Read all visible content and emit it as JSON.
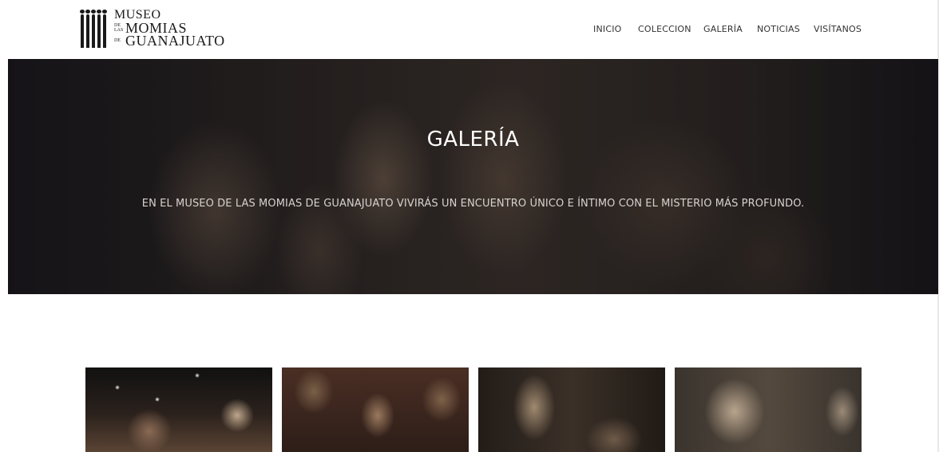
{
  "brand": {
    "line1": "MUSEO",
    "small_de1": "DE",
    "small_las": "LAS",
    "small_de2": "DE",
    "line2": "MOMIAS",
    "line3": "GUANAJUATO"
  },
  "nav": {
    "items": [
      {
        "label": "INICIO"
      },
      {
        "label": "COLECCION"
      },
      {
        "label": "GALERÍA"
      },
      {
        "label": "NOTICIAS"
      },
      {
        "label": "VISÍTANOS"
      }
    ]
  },
  "hero": {
    "title": "GALERÍA",
    "subtitle": "EN EL MUSEO DE LAS MOMIAS DE GUANAJUATO VIVIRÁS UN ENCUENTRO ÚNICO E ÍNTIMO CON EL MISTERIO MÁS PROFUNDO."
  },
  "gallery": {
    "item_count": 4
  }
}
